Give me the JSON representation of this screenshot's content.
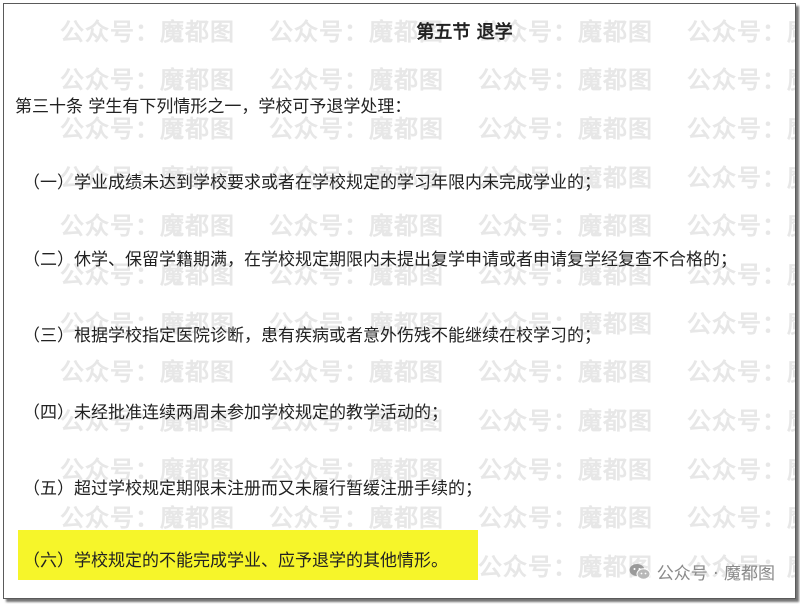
{
  "document": {
    "section_title": "第五节 退学",
    "article_intro": "第三十条 学生有下列情形之一，学校可予退学处理：",
    "clauses": [
      "（一）学业成绩未达到学校要求或者在学校规定的学习年限内未完成学业的；",
      "（二）休学、保留学籍期满，在学校规定期限内未提出复学申请或者申请复学经复查不合格的；",
      "（三）根据学校指定医院诊断，患有疾病或者意外伤残不能继续在校学习的；",
      "（四）未经批准连续两周未参加学校规定的教学活动的；",
      "（五）超过学校规定期限未注册而又未履行暂缓注册手续的；",
      "（六）学校规定的不能完成学业、应予退学的其他情形。"
    ]
  },
  "watermark": {
    "text": "公众号：魔都图"
  },
  "brand": {
    "icon": "wechat-icon",
    "text": "公众号 · 魔都图"
  },
  "colors": {
    "highlight": "#f6f52a",
    "text": "#222222",
    "watermark": "#e7e7e7",
    "brand": "#8a8a8a"
  }
}
